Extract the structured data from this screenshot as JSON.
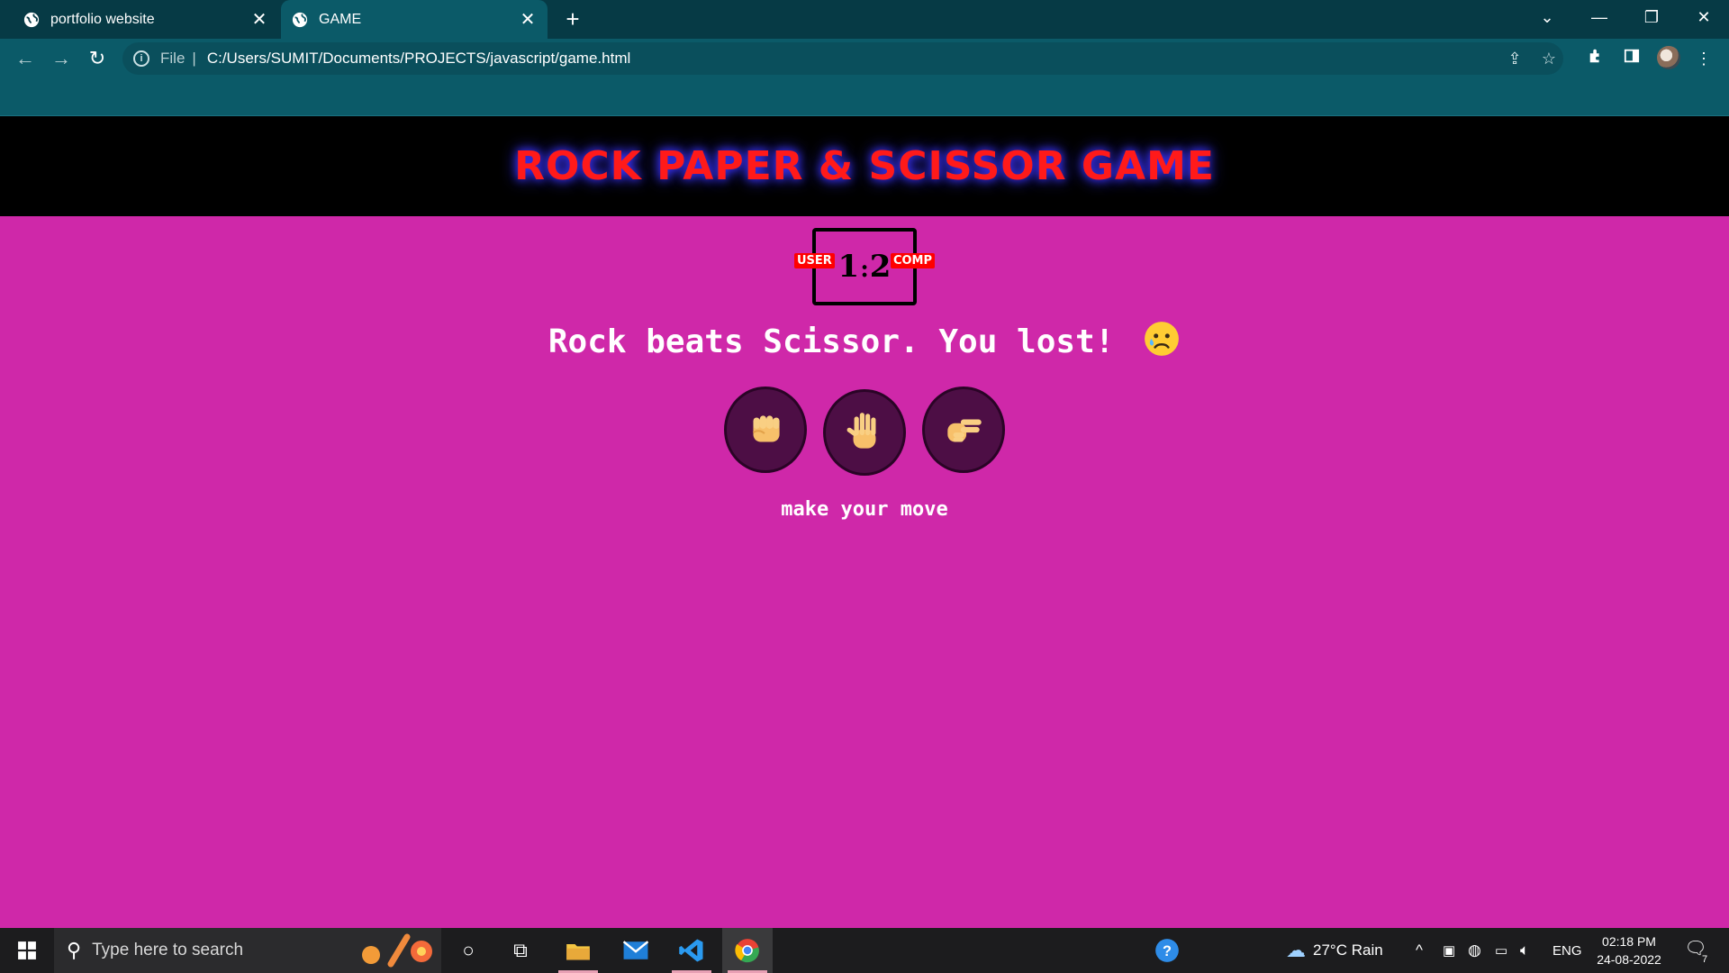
{
  "browser": {
    "tabs": [
      {
        "title": "portfolio website",
        "icon": "globe-icon",
        "active": false
      },
      {
        "title": "GAME",
        "icon": "globe-icon",
        "active": true
      }
    ],
    "close_glyph": "✕",
    "new_tab_glyph": "+",
    "address": {
      "scheme_label": "File",
      "separator": "|",
      "url": "C:/Users/SUMIT/Documents/PROJECTS/javascript/game.html"
    },
    "colors": {
      "tabbar": "#063a45",
      "toolbar": "#0b5a68"
    }
  },
  "game": {
    "title": "ROCK PAPER & SCISSOR GAME",
    "score": {
      "user_label": "USER",
      "comp_label": "COMP",
      "user": "1",
      "separator": ":",
      "comp": "2"
    },
    "result_message": "Rock beats Scissor. You lost!",
    "result_emoji": "sad-face-icon",
    "choices": [
      {
        "name": "rock",
        "icon": "fist-icon"
      },
      {
        "name": "paper",
        "icon": "open-hand-icon"
      },
      {
        "name": "scissor",
        "icon": "victory-hand-icon"
      }
    ],
    "prompt": "make your move",
    "colors": {
      "background": "#cf28a9",
      "header": "#000000",
      "title": "#ff1a1a",
      "title_glow": "#3b34ff",
      "button": "#4d0e45"
    }
  },
  "taskbar": {
    "search_placeholder": "Type here to search",
    "weather": "27°C  Rain",
    "language": "ENG",
    "time": "02:18 PM",
    "date": "24-08-2022",
    "notification_count": "7"
  }
}
